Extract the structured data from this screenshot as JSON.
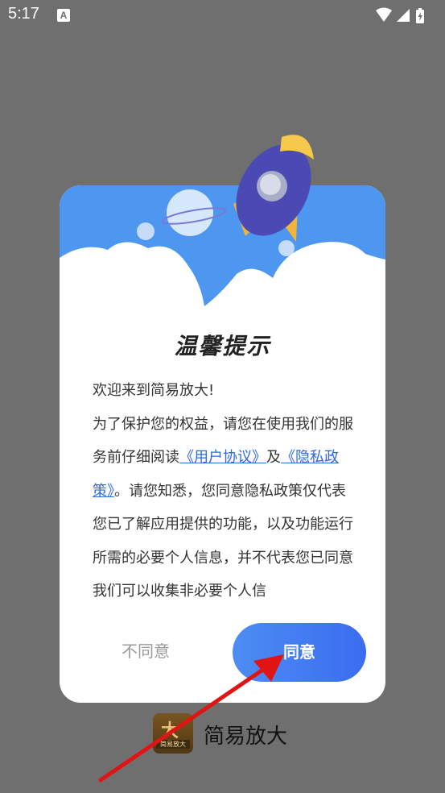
{
  "status_bar": {
    "time": "5:17",
    "notif_letter": "A"
  },
  "dialog": {
    "title": "温馨提示",
    "line1": "欢迎来到简易放大!",
    "line2": "为了保护您的权益，请您在使用我们的服务前仔细阅读",
    "link_user": "《用户协议》",
    "and": "及",
    "link_privacy": "《隐私政策》",
    "line3": "。请您知悉，您同意隐私政策仅代表您已了解应用提供的功能，以及功能运行所需的必要个人信息，并不代表您已同意我们可以收集非必要个人信",
    "disagree_label": "不同意",
    "agree_label": "同意"
  },
  "app": {
    "name": "简易放大",
    "icon_char": "大",
    "icon_caption": "简易放大"
  },
  "colors": {
    "accent": "#3a6cf0",
    "header": "#4d97f1",
    "annotation_arrow": "#e11414"
  }
}
